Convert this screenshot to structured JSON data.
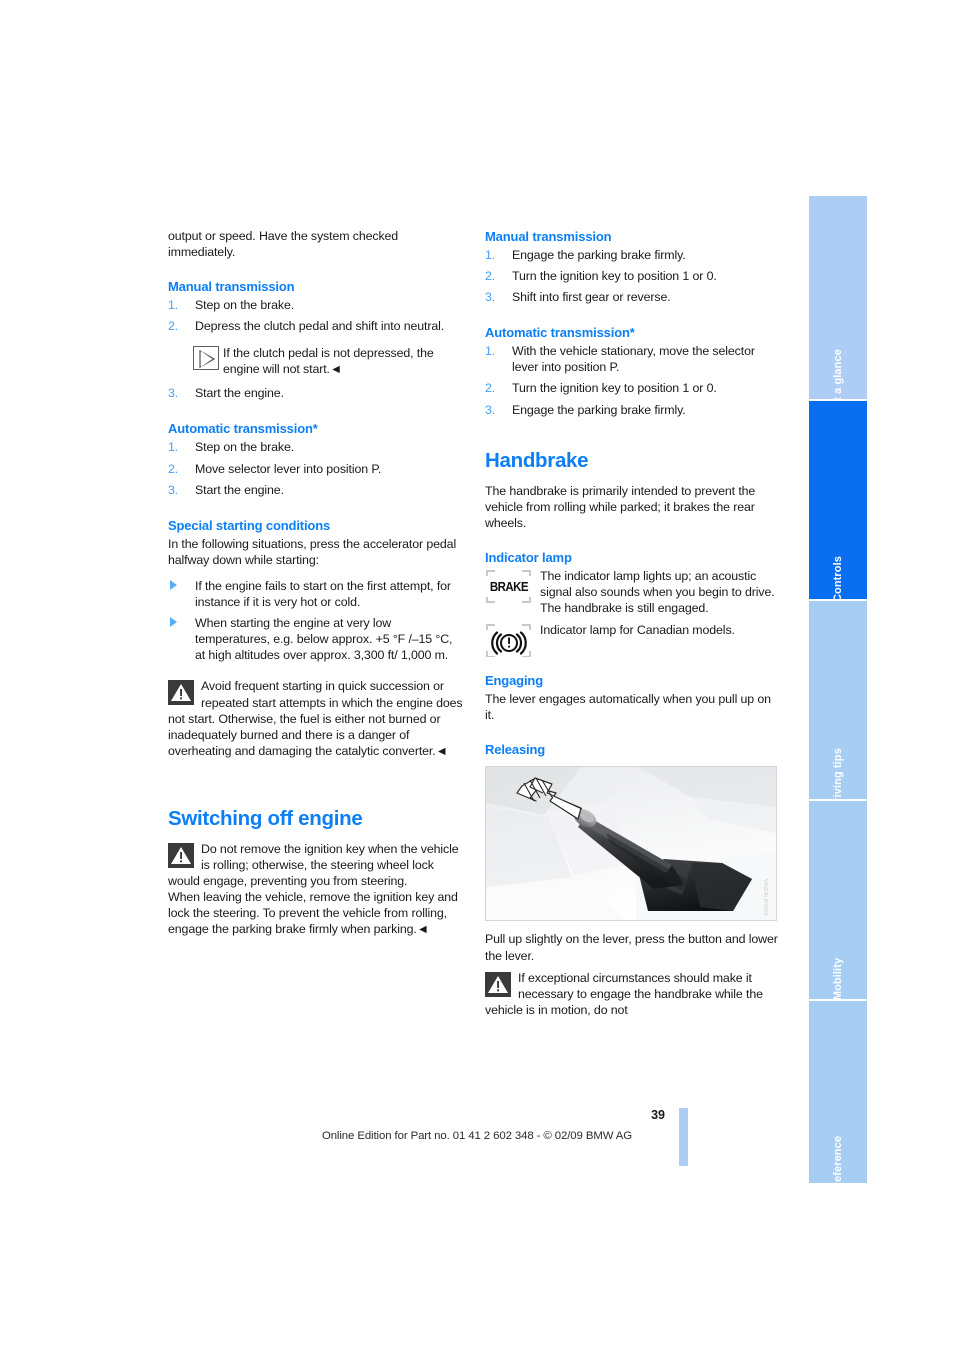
{
  "page": {
    "number": "39",
    "footer": "Online Edition for Part no. 01 41 2 602 348 - © 02/09 BMW AG"
  },
  "sidebar": {
    "tabs": [
      {
        "label": "At a glance",
        "active": false
      },
      {
        "label": "Controls",
        "active": true
      },
      {
        "label": "Driving tips",
        "active": false
      },
      {
        "label": "Mobility",
        "active": false
      },
      {
        "label": "Reference",
        "active": false
      }
    ],
    "active_color": "#0a6ef0",
    "inactive_color": "#a8cdf2"
  },
  "left_column": {
    "intro": "output or speed. Have the system checked immediately.",
    "manual_transmission": {
      "heading": "Manual transmission",
      "steps": [
        {
          "num": "1.",
          "text": "Step on the brake."
        },
        {
          "num": "2.",
          "text": "Depress the clutch pedal and shift into neutral."
        },
        {
          "num": "3.",
          "text": "Start the engine."
        }
      ],
      "note": "If the clutch pedal is not depressed, the engine will not start.◄"
    },
    "automatic_transmission": {
      "heading": "Automatic transmission*",
      "steps": [
        {
          "num": "1.",
          "text": "Step on the brake."
        },
        {
          "num": "2.",
          "text": "Move selector lever into position P."
        },
        {
          "num": "3.",
          "text": "Start the engine."
        }
      ]
    },
    "special_starting": {
      "heading": "Special starting conditions",
      "intro": "In the following situations, press the accelerator pedal halfway down while starting:",
      "bullets": [
        "If the engine fails to start on the first attempt, for instance if it is very hot or cold.",
        "When starting the engine at very low temperatures, e.g. below approx. +5 °F /–15 °C, at high altitudes over approx. 3,300 ft/ 1,000 m."
      ],
      "warning": "Avoid frequent starting in quick succession or repeated start attempts in which the engine does not start. Otherwise, the fuel is either not burned or inadequately burned and there is a danger of overheating and damaging the catalytic converter.◄"
    },
    "switching_off": {
      "heading": "Switching off engine",
      "warning": "Do not remove the ignition key when the vehicle is rolling; otherwise, the steering wheel lock would engage, preventing you from steering.",
      "warning_cont": "When leaving the vehicle, remove the ignition key and lock the steering. To prevent the vehicle from rolling, engage the parking brake firmly when parking.◄"
    }
  },
  "right_column": {
    "manual_transmission": {
      "heading": "Manual transmission",
      "steps": [
        {
          "num": "1.",
          "text": "Engage the parking brake firmly."
        },
        {
          "num": "2.",
          "text": "Turn the ignition key to position 1 or 0."
        },
        {
          "num": "3.",
          "text": "Shift into first gear or reverse."
        }
      ]
    },
    "automatic_transmission": {
      "heading": "Automatic transmission*",
      "steps": [
        {
          "num": "1.",
          "text": "With the vehicle stationary, move the selector lever into position P."
        },
        {
          "num": "2.",
          "text": "Turn the ignition key to position 1 or 0."
        },
        {
          "num": "3.",
          "text": "Engage the parking brake firmly."
        }
      ]
    },
    "handbrake": {
      "heading": "Handbrake",
      "intro": "The handbrake is primarily intended to prevent the vehicle from rolling while parked; it brakes the rear wheels.",
      "indicator_lamp": {
        "heading": "Indicator lamp",
        "rows": [
          {
            "icon": "brake-lamp-icon",
            "icon_text": "BRAKE",
            "text": "The indicator lamp lights up; an acoustic signal also sounds when you begin to drive. The handbrake is still engaged."
          },
          {
            "icon": "canadian-brake-lamp-icon",
            "icon_text": "",
            "text": "Indicator lamp for Canadian models."
          }
        ]
      },
      "engaging": {
        "heading": "Engaging",
        "text": "The lever engages automatically when you pull up on it."
      },
      "releasing": {
        "heading": "Releasing",
        "figure_caption": "Pull up slightly on the lever, press the button and lower the lever.",
        "figure_watermark": "VKG4LRSWh",
        "warning": "If exceptional circumstances should make it necessary to engage the handbrake while the vehicle is in motion, do not"
      }
    }
  }
}
